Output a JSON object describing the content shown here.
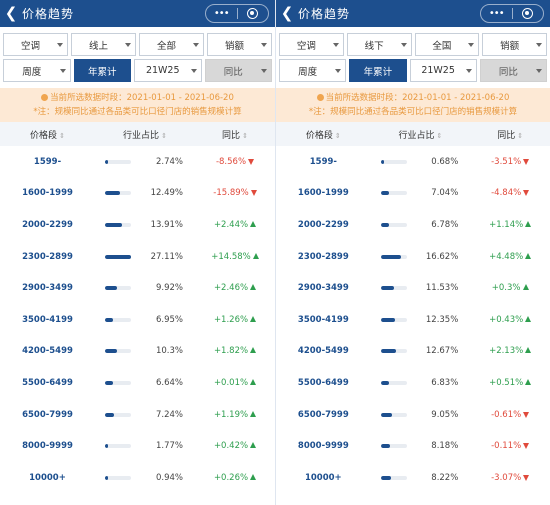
{
  "colors": {
    "primary": "#1d4f8e",
    "up": "#2e9e4e",
    "down": "#e04a3c",
    "notice_bg": "#fde9d5",
    "notice_text": "#e8993f"
  },
  "screens": [
    {
      "title": "价格趋势",
      "filters_row1": [
        "空调",
        "线上",
        "全部",
        "销额"
      ],
      "filters_row2": [
        "周度",
        "年累计",
        "21W25",
        "同比"
      ],
      "notice_line1": "当前所选数据时段：2021-01-01 - 2021-06-20",
      "notice_line2": "*注：规模同比通过各品类可比口径门店的销售规模计算",
      "headers": [
        "价格段",
        "行业占比",
        "同比"
      ],
      "rows": [
        {
          "segment": "1599-",
          "share": "2.74%",
          "share_value": 2.74,
          "yoy": "-8.56%",
          "dir": "down"
        },
        {
          "segment": "1600-1999",
          "share": "12.49%",
          "share_value": 12.49,
          "yoy": "-15.89%",
          "dir": "down"
        },
        {
          "segment": "2000-2299",
          "share": "13.91%",
          "share_value": 13.91,
          "yoy": "+2.44%",
          "dir": "up"
        },
        {
          "segment": "2300-2899",
          "share": "27.11%",
          "share_value": 27.11,
          "yoy": "+14.58%",
          "dir": "up"
        },
        {
          "segment": "2900-3499",
          "share": "9.92%",
          "share_value": 9.92,
          "yoy": "+2.46%",
          "dir": "up"
        },
        {
          "segment": "3500-4199",
          "share": "6.95%",
          "share_value": 6.95,
          "yoy": "+1.26%",
          "dir": "up"
        },
        {
          "segment": "4200-5499",
          "share": "10.3%",
          "share_value": 10.3,
          "yoy": "+1.82%",
          "dir": "up"
        },
        {
          "segment": "5500-6499",
          "share": "6.64%",
          "share_value": 6.64,
          "yoy": "+0.01%",
          "dir": "up"
        },
        {
          "segment": "6500-7999",
          "share": "7.24%",
          "share_value": 7.24,
          "yoy": "+1.19%",
          "dir": "up"
        },
        {
          "segment": "8000-9999",
          "share": "1.77%",
          "share_value": 1.77,
          "yoy": "+0.42%",
          "dir": "up"
        },
        {
          "segment": "10000+",
          "share": "0.94%",
          "share_value": 0.94,
          "yoy": "+0.26%",
          "dir": "up"
        }
      ]
    },
    {
      "title": "价格趋势",
      "filters_row1": [
        "空调",
        "线下",
        "全国",
        "销额"
      ],
      "filters_row2": [
        "周度",
        "年累计",
        "21W25",
        "同比"
      ],
      "notice_line1": "当前所选数据时段：2021-01-01 - 2021-06-20",
      "notice_line2": "*注：规模同比通过各品类可比口径门店的销售规模计算",
      "headers": [
        "价格段",
        "行业占比",
        "同比"
      ],
      "rows": [
        {
          "segment": "1599-",
          "share": "0.68%",
          "share_value": 0.68,
          "yoy": "-3.51%",
          "dir": "down"
        },
        {
          "segment": "1600-1999",
          "share": "7.04%",
          "share_value": 7.04,
          "yoy": "-4.84%",
          "dir": "down"
        },
        {
          "segment": "2000-2299",
          "share": "6.78%",
          "share_value": 6.78,
          "yoy": "+1.14%",
          "dir": "up"
        },
        {
          "segment": "2300-2899",
          "share": "16.62%",
          "share_value": 16.62,
          "yoy": "+4.48%",
          "dir": "up"
        },
        {
          "segment": "2900-3499",
          "share": "11.53%",
          "share_value": 11.53,
          "yoy": "+0.3%",
          "dir": "up"
        },
        {
          "segment": "3500-4199",
          "share": "12.35%",
          "share_value": 12.35,
          "yoy": "+0.43%",
          "dir": "up"
        },
        {
          "segment": "4200-5499",
          "share": "12.67%",
          "share_value": 12.67,
          "yoy": "+2.13%",
          "dir": "up"
        },
        {
          "segment": "5500-6499",
          "share": "6.83%",
          "share_value": 6.83,
          "yoy": "+0.51%",
          "dir": "up"
        },
        {
          "segment": "6500-7999",
          "share": "9.05%",
          "share_value": 9.05,
          "yoy": "-0.61%",
          "dir": "down"
        },
        {
          "segment": "8000-9999",
          "share": "8.18%",
          "share_value": 8.18,
          "yoy": "-0.11%",
          "dir": "down"
        },
        {
          "segment": "10000+",
          "share": "8.22%",
          "share_value": 8.22,
          "yoy": "-3.07%",
          "dir": "down"
        }
      ]
    }
  ]
}
